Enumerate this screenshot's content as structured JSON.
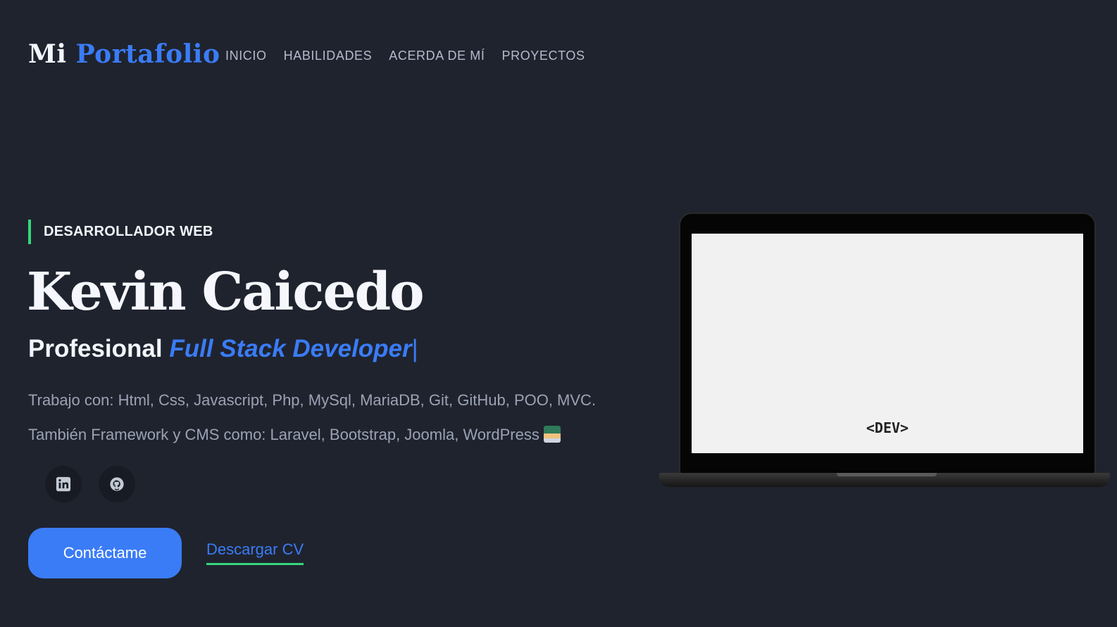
{
  "header": {
    "logo_part1": "Mi",
    "logo_part2": "Portafolio",
    "nav": [
      "INICIO",
      "HABILIDADES",
      "ACERDA DE MÍ",
      "PROYECTOS"
    ]
  },
  "hero": {
    "eyebrow": "DESARROLLADOR WEB",
    "name": "Kevin Caicedo",
    "role_prefix": "Profesional",
    "role_highlight": "Full Stack Developer",
    "caret": "|",
    "line1": "Trabajo con: Html, Css, Javascript, Php, MySql, MariaDB, Git, GitHub, POO, MVC.",
    "line2": "También Framework y CMS como: Laravel, Bootstrap, Joomla, WordPress",
    "social": [
      "linkedin-icon",
      "github-icon"
    ],
    "contact_label": "Contáctame",
    "cv_label": "Descargar CV"
  },
  "laptop": {
    "screen_text": "<DEV>"
  },
  "colors": {
    "background": "#1f232e",
    "accent": "#3a7cf6",
    "green": "#36d67a"
  }
}
